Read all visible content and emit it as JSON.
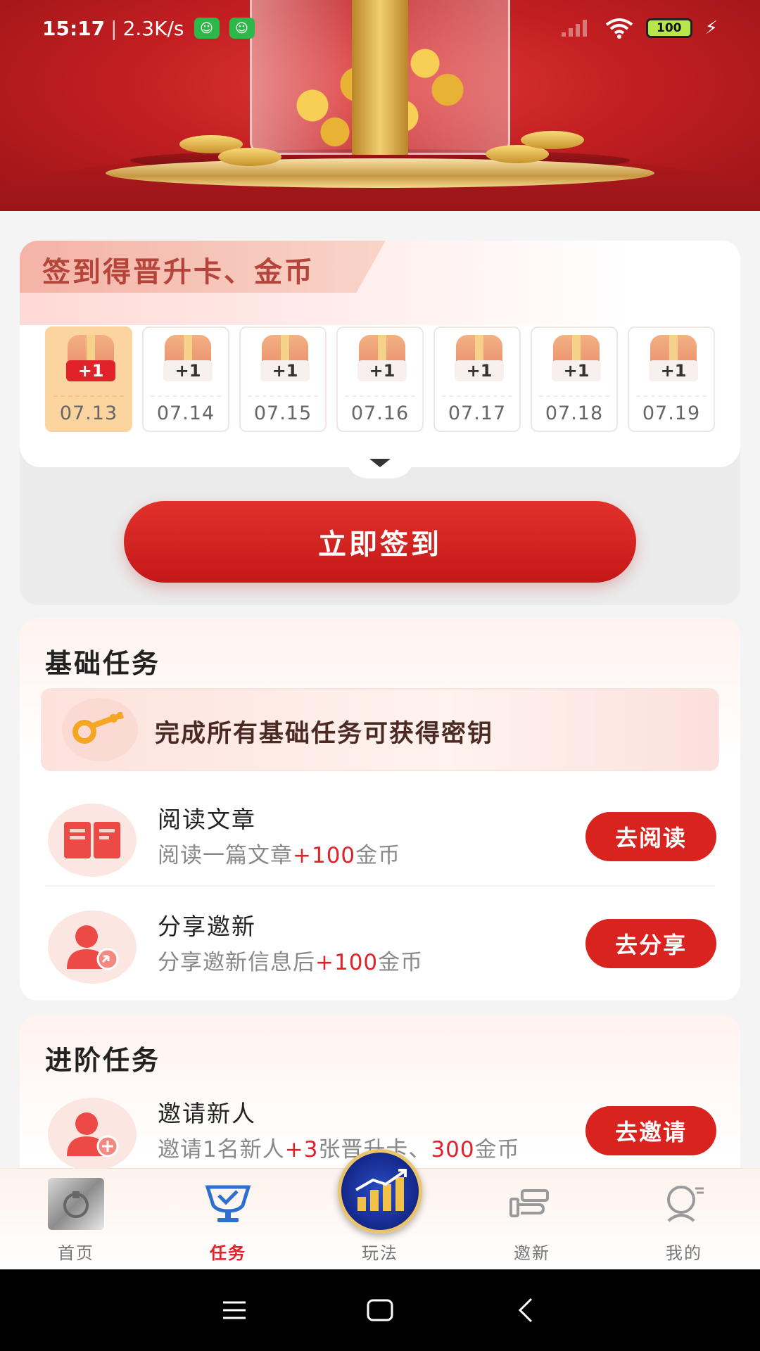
{
  "status_bar": {
    "time": "15:17",
    "speed": "2.3K/s",
    "battery": "100"
  },
  "signin": {
    "title": "签到得晋升卡、金币",
    "days": [
      {
        "date": "07.13",
        "reward": "+1",
        "active": true
      },
      {
        "date": "07.14",
        "reward": "+1",
        "active": false
      },
      {
        "date": "07.15",
        "reward": "+1",
        "active": false
      },
      {
        "date": "07.16",
        "reward": "+1",
        "active": false
      },
      {
        "date": "07.17",
        "reward": "+1",
        "active": false
      },
      {
        "date": "07.18",
        "reward": "+1",
        "active": false
      },
      {
        "date": "07.19",
        "reward": "+1",
        "active": false
      }
    ],
    "button_label": "立即签到"
  },
  "basic_tasks": {
    "title": "基础任务",
    "key_banner": "完成所有基础任务可获得密钥",
    "items": [
      {
        "name": "阅读文章",
        "desc_prefix": "阅读一篇文章",
        "desc_highlight": "+100",
        "desc_suffix": "金币",
        "button": "去阅读"
      },
      {
        "name": "分享邀新",
        "desc_prefix": "分享邀新信息后",
        "desc_highlight": "+100",
        "desc_suffix": "金币",
        "button": "去分享"
      }
    ]
  },
  "advanced_tasks": {
    "title": "进阶任务",
    "items": [
      {
        "name": "邀请新人",
        "desc_1": "邀请1名新人",
        "hl_1": "+3",
        "desc_2": "张晋升卡、",
        "hl_2": "300",
        "desc_3": "金币",
        "button": "去邀请"
      }
    ]
  },
  "bottom_nav": {
    "items": [
      {
        "label": "首页",
        "icon": "home-thumbnail",
        "active": false
      },
      {
        "label": "任务",
        "icon": "trophy-check-icon",
        "active": true
      },
      {
        "label": "玩法",
        "icon": "growth-chart-icon",
        "active": false
      },
      {
        "label": "邀新",
        "icon": "handshake-icon",
        "active": false
      },
      {
        "label": "我的",
        "icon": "profile-bust-icon",
        "active": false
      }
    ]
  },
  "colors": {
    "accent_red": "#d8231f",
    "highlight_red": "#e0222a",
    "active_day": "#fcd4a0"
  }
}
